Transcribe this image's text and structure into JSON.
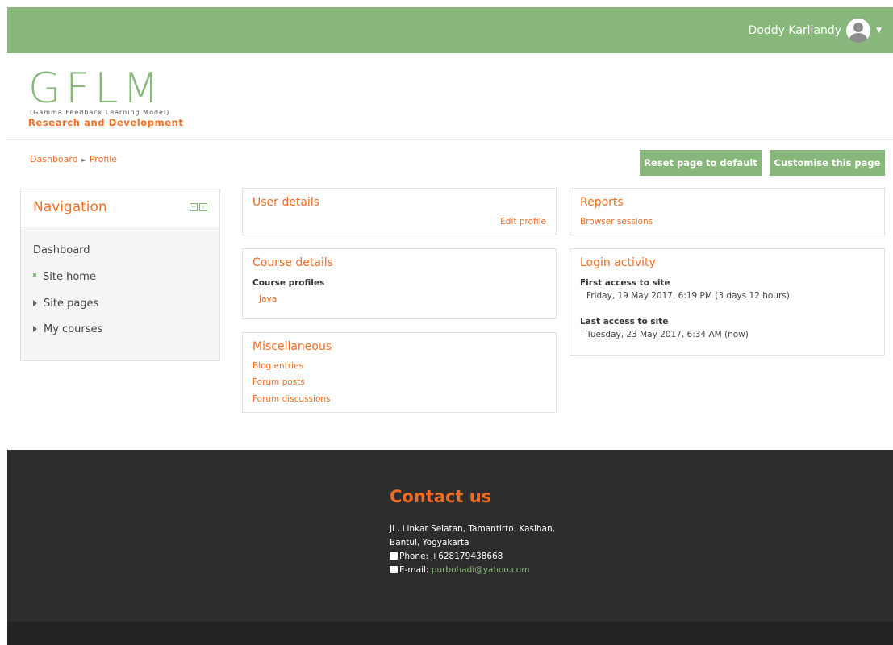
{
  "header": {
    "user_name": "Doddy Karliandy"
  },
  "logo": {
    "main": "GFLM",
    "tagline": "(Gamma Feedback Learning Model)",
    "subtitle": "Research and Development"
  },
  "breadcrumb": {
    "items": [
      "Dashboard",
      "Profile"
    ]
  },
  "actions": {
    "reset_label": "Reset page to default",
    "customise_label": "Customise this page"
  },
  "navigation": {
    "title": "Navigation",
    "root": "Dashboard",
    "items": [
      "Site home",
      "Site pages",
      "My courses"
    ]
  },
  "user_details": {
    "title": "User details",
    "edit_link": "Edit profile"
  },
  "course_details": {
    "title": "Course details",
    "label": "Course profiles",
    "course": "Java"
  },
  "miscellaneous": {
    "title": "Miscellaneous",
    "links": [
      "Blog entries",
      "Forum posts",
      "Forum discussions"
    ]
  },
  "reports": {
    "title": "Reports",
    "link": "Browser sessions"
  },
  "login_activity": {
    "title": "Login activity",
    "first_label": "First access to site",
    "first_value": "Friday, 19 May 2017, 6:19 PM  (3 days 12 hours)",
    "last_label": "Last access to site",
    "last_value": "Tuesday, 23 May 2017, 6:34 AM  (now)"
  },
  "footer": {
    "title": "Contact us",
    "address1": "JL. Linkar Selatan, Tamantirto, Kasihan,",
    "address2": "Bantul, Yogyakarta",
    "phone": "Phone: +628179438668",
    "email_label": "E-mail: ",
    "email": "purbohadi@yahoo.com"
  },
  "colors": {
    "accent_green": "#88b77b",
    "accent_orange": "#f26b22",
    "footer_bg": "#2d2d2d"
  },
  "icons": [
    "user-avatar-icon",
    "caret-down-icon",
    "block-dock-icon",
    "block-collapse-icon",
    "bullet-icon",
    "expand-arrow-icon",
    "phone-icon",
    "envelope-icon"
  ]
}
